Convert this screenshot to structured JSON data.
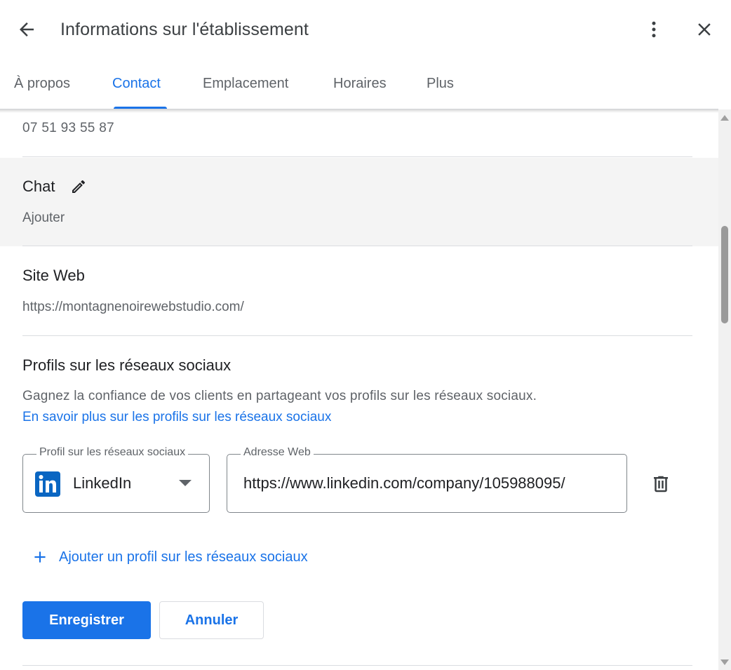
{
  "header": {
    "title": "Informations sur l'établissement",
    "back_icon": "arrow-left-icon",
    "more_icon": "more-vert-icon",
    "close_icon": "close-icon"
  },
  "tabs": [
    {
      "label": "À propos",
      "active": false
    },
    {
      "label": "Contact",
      "active": true
    },
    {
      "label": "Emplacement",
      "active": false
    },
    {
      "label": "Horaires",
      "active": false
    },
    {
      "label": "Plus",
      "active": false
    }
  ],
  "contact": {
    "phone_value": "07 51 93 55 87",
    "chat": {
      "title": "Chat",
      "value": "Ajouter",
      "edit_icon": "pencil-icon"
    },
    "website": {
      "title": "Site Web",
      "value": "https://montagnenoirewebstudio.com/"
    },
    "social": {
      "title": "Profils sur les réseaux sociaux",
      "description": "Gagnez la confiance de vos clients en partageant vos profils sur les réseaux sociaux.",
      "learn_more": "En savoir plus sur les profils sur les réseaux sociaux",
      "profile_label": "Profil sur les réseaux sociaux",
      "profile_value": "LinkedIn",
      "profile_icon": "linkedin-logo-icon",
      "url_label": "Adresse Web",
      "url_value": "https://www.linkedin.com/company/105988095/",
      "delete_icon": "trash-icon",
      "add_label": "Ajouter un profil sur les réseaux sociaux",
      "add_icon": "plus-icon"
    }
  },
  "actions": {
    "save": "Enregistrer",
    "cancel": "Annuler"
  },
  "colors": {
    "accent": "#1a73e8",
    "linkedin": "#0a66c2",
    "row_highlight": "#f4f4f4"
  }
}
